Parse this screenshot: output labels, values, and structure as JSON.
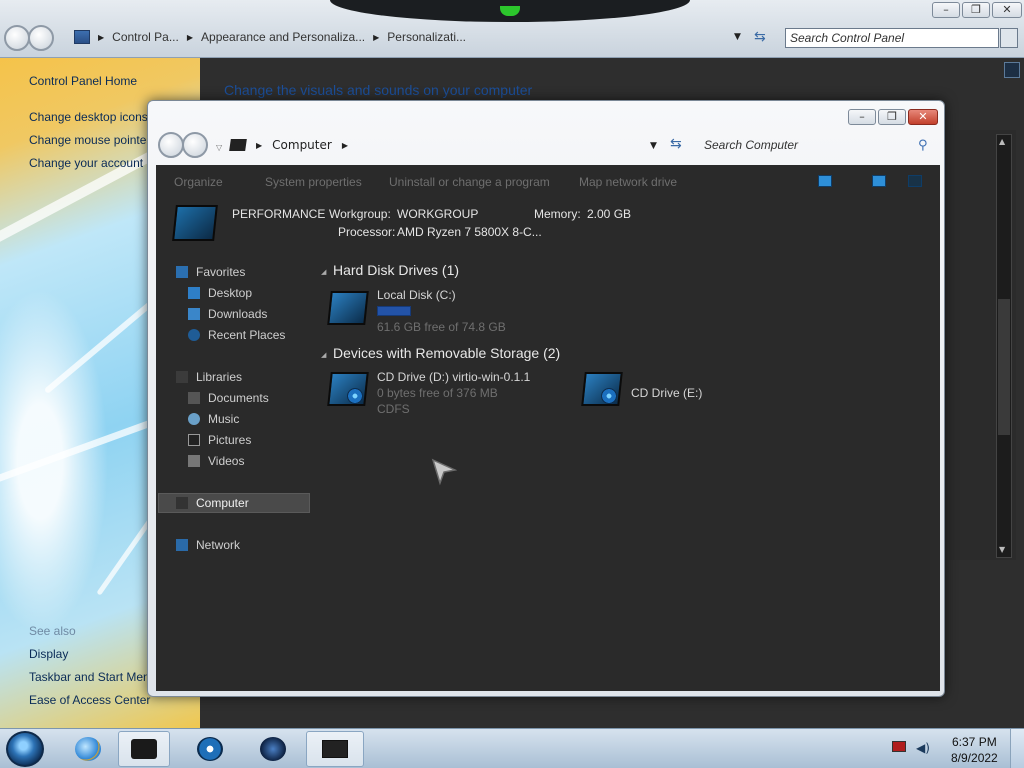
{
  "control_panel": {
    "breadcrumb": [
      "Control Pa...",
      "Appearance and Personaliza...",
      "Personalizati..."
    ],
    "search_placeholder": "Search Control Panel",
    "main_link": "Change the visuals and sounds on your computer",
    "sidebar": {
      "home": "Control Panel Home",
      "links": [
        "Change desktop icons",
        "Change mouse pointe",
        "Change your account"
      ],
      "see_also": "See also",
      "see_also_links": [
        "Display",
        "Taskbar and Start Men",
        "Ease of Access Center"
      ]
    }
  },
  "window_controls": {
    "minimize": "–",
    "maximize": "❐",
    "close": "✕"
  },
  "computer_window": {
    "address": "Computer",
    "search_placeholder": "Search Computer",
    "toolbar": [
      "Organize",
      "System properties",
      "Uninstall or change a program",
      "Map network drive"
    ],
    "details": {
      "name": "PERFORMANCE",
      "workgroup_label": "Workgroup:",
      "workgroup": "WORKGROUP",
      "memory_label": "Memory:",
      "memory": "2.00 GB",
      "processor_label": "Processor:",
      "processor": "AMD Ryzen 7 5800X 8-C..."
    },
    "nav": {
      "favorites": "Favorites",
      "favorites_items": [
        "Desktop",
        "Downloads",
        "Recent Places"
      ],
      "libraries": "Libraries",
      "libraries_items": [
        "Documents",
        "Music",
        "Pictures",
        "Videos"
      ],
      "computer": "Computer",
      "network": "Network"
    },
    "groups": [
      {
        "title": "Hard Disk Drives (1)",
        "drives": [
          {
            "name": "Local Disk (C:)",
            "free": "61.6 GB free of 74.8 GB",
            "used_fraction": 0.18
          }
        ]
      },
      {
        "title": "Devices with Removable Storage (2)",
        "drives": [
          {
            "name": "CD Drive (D:) virtio-win-0.1.1",
            "free": "0 bytes free of 376 MB",
            "fs": "CDFS"
          },
          {
            "name": "CD Drive (E:)"
          }
        ]
      }
    ]
  },
  "taskbar": {
    "time": "6:37 PM",
    "date": "8/9/2022"
  }
}
